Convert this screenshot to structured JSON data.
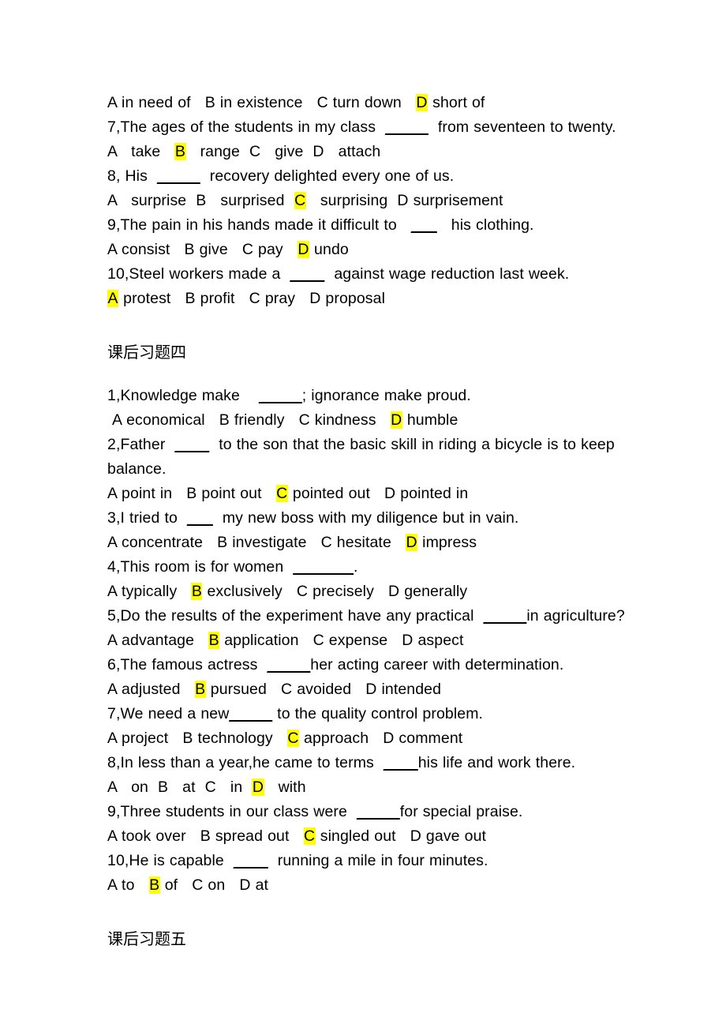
{
  "document": {
    "page_background": "#ffffff",
    "text_color": "#000000",
    "highlight_color": "#ffff00",
    "blocks": [
      {
        "id": "q6-options",
        "kind": "options",
        "text": "A in need of   B in existence   C turn down   D short of",
        "pre": "A in need of   B in existence   C turn down   ",
        "highlight": "D",
        "post": " short of"
      },
      {
        "id": "q7-stem",
        "kind": "stem",
        "text": "7,The ages of the students in my class  _____  from seventeen to twenty.",
        "pre": "7,The ages of the students in my class  ",
        "blank": "_____",
        "post": "  from seventeen to twenty."
      },
      {
        "id": "q7-options",
        "kind": "options",
        "text": "A   take   B   range  C   give  D   attach",
        "pre": "A   take   ",
        "highlight": "B",
        "post": "   range  C   give  D   attach"
      },
      {
        "id": "q8-stem",
        "kind": "stem",
        "text": "8, His  _____  recovery delighted every one of us.",
        "pre": "8, His  ",
        "blank": "_____",
        "post": "  recovery delighted every one of us."
      },
      {
        "id": "q8-options",
        "kind": "options",
        "text": "A   surprise  B   surprised  C   surprising  D surprisement",
        "pre": "A   surprise  B   surprised  ",
        "highlight": "C",
        "post": "   surprising  D surprisement"
      },
      {
        "id": "q9-stem",
        "kind": "stem",
        "text": "9,The pain in his hands made it difficult to  ___   his clothing.",
        "pre": "9,The pain in his hands made it difficult to   ",
        "blank": "___",
        "post": "   his clothing."
      },
      {
        "id": "q9-options",
        "kind": "options",
        "text": "A consist   B give   C pay   D undo",
        "pre": "A consist   B give   C pay   ",
        "highlight": "D",
        "post": " undo"
      },
      {
        "id": "q10-stem",
        "kind": "stem",
        "text": "10,Steel workers made a  ____  against wage reduction last week.",
        "pre": "10,Steel workers made a  ",
        "blank": "____",
        "post": "  against wage reduction last week."
      },
      {
        "id": "q10-options",
        "kind": "options",
        "text": "A protest   B profit   C pray   D proposal",
        "pre": "",
        "highlight": "A",
        "post": " protest   B profit   C pray   D proposal"
      },
      {
        "id": "heading-4",
        "kind": "heading",
        "text": "课后习题四"
      },
      {
        "id": "s4-q1-stem",
        "kind": "stem",
        "text": "1,Knowledge make    _____; ignorance make proud.",
        "pre": "1,Knowledge make    ",
        "blank": "_____",
        "post": "; ignorance make proud."
      },
      {
        "id": "s4-q1-options",
        "kind": "options-indent",
        "text": " A economical   B friendly   C kindness   D humble",
        "pre": " A economical   B friendly   C kindness   ",
        "highlight": "D",
        "post": " humble"
      },
      {
        "id": "s4-q2-stem",
        "kind": "stem",
        "text": "2,Father  ____  to the son that the basic skill in riding a bicycle is to keep balance.",
        "pre": "2,Father  ",
        "blank": "____",
        "post": "  to the son that the basic skill in riding a bicycle is to keep balance."
      },
      {
        "id": "s4-q2-options",
        "kind": "options",
        "text": "A point in   B point out   C pointed out   D pointed in",
        "pre": "A point in   B point out   ",
        "highlight": "C",
        "post": " pointed out   D pointed in"
      },
      {
        "id": "s4-q3-stem",
        "kind": "stem",
        "text": "3,I tried to  ___  my new boss with my diligence but in vain.",
        "pre": "3,I tried to  ",
        "blank": "___",
        "post": "  my new boss with my diligence but in vain."
      },
      {
        "id": "s4-q3-options",
        "kind": "options",
        "text": "A concentrate   B investigate   C hesitate   D impress",
        "pre": "A concentrate   B investigate   C hesitate   ",
        "highlight": "D",
        "post": " impress"
      },
      {
        "id": "s4-q4-stem",
        "kind": "stem",
        "text": "4,This room is for women  _______.",
        "pre": "4,This room is for women  ",
        "blank": "_______",
        "post": "."
      },
      {
        "id": "s4-q4-options",
        "kind": "options",
        "text": "A typically   B exclusively   C precisely   D generally",
        "pre": "A typically   ",
        "highlight": "B",
        "post": " exclusively   C precisely   D generally"
      },
      {
        "id": "s4-q5-stem",
        "kind": "stem",
        "text": "5,Do the results of the experiment have any practical  _____in agriculture?",
        "pre": "5,Do the results of the experiment have any practical  ",
        "blank": "_____",
        "post": "in agriculture?"
      },
      {
        "id": "s4-q5-options",
        "kind": "options",
        "text": "A advantage   B application   C expense   D aspect",
        "pre": "A advantage   ",
        "highlight": "B",
        "post": " application   C expense   D aspect"
      },
      {
        "id": "s4-q6-stem",
        "kind": "stem",
        "text": "6,The famous actress  _____her acting career with determination.",
        "pre": "6,The famous actress  ",
        "blank": "_____",
        "post": "her acting career with determination."
      },
      {
        "id": "s4-q6-options",
        "kind": "options",
        "text": "A adjusted   B pursued   C avoided   D intended",
        "pre": "A adjusted   ",
        "highlight": "B",
        "post": " pursued   C avoided   D intended"
      },
      {
        "id": "s4-q7-stem",
        "kind": "stem",
        "text": "7,We need a new_____ to the quality control problem.",
        "pre": "7,We need a new",
        "blank": "_____",
        "post": " to the quality control problem."
      },
      {
        "id": "s4-q7-options",
        "kind": "options",
        "text": "A project   B technology   C approach   D comment",
        "pre": "A project   B technology   ",
        "highlight": "C",
        "post": " approach   D comment"
      },
      {
        "id": "s4-q8-stem",
        "kind": "stem",
        "text": "8,In less than a year,he came to terms  ____his life and work there.",
        "pre": "8,In less than a year,he came to terms  ",
        "blank": "____",
        "post": "his life and work there."
      },
      {
        "id": "s4-q8-options",
        "kind": "options",
        "text": "A   on  B   at  C   in  D   with",
        "pre": "A   on  B   at  C   in  ",
        "highlight": "D",
        "post": "   with"
      },
      {
        "id": "s4-q9-stem",
        "kind": "stem",
        "text": "9,Three students in our class were  _____for special praise.",
        "pre": "9,Three students in our class were  ",
        "blank": "_____",
        "post": "for special praise."
      },
      {
        "id": "s4-q9-options",
        "kind": "options",
        "text": "A took over   B spread out   C singled out   D gave out",
        "pre": "A took over   B spread out   ",
        "highlight": "C",
        "post": " singled out   D gave out"
      },
      {
        "id": "s4-q10-stem",
        "kind": "stem",
        "text": "10,He is capable  ____  running a mile in four minutes.",
        "pre": "10,He is capable  ",
        "blank": "____",
        "post": "  running a mile in four minutes."
      },
      {
        "id": "s4-q10-options",
        "kind": "options",
        "text": "A to   B of   C on   D at",
        "pre": "A to   ",
        "highlight": "B",
        "post": " of   C on   D at"
      },
      {
        "id": "heading-5",
        "kind": "heading",
        "text": "课后习题五"
      }
    ]
  }
}
